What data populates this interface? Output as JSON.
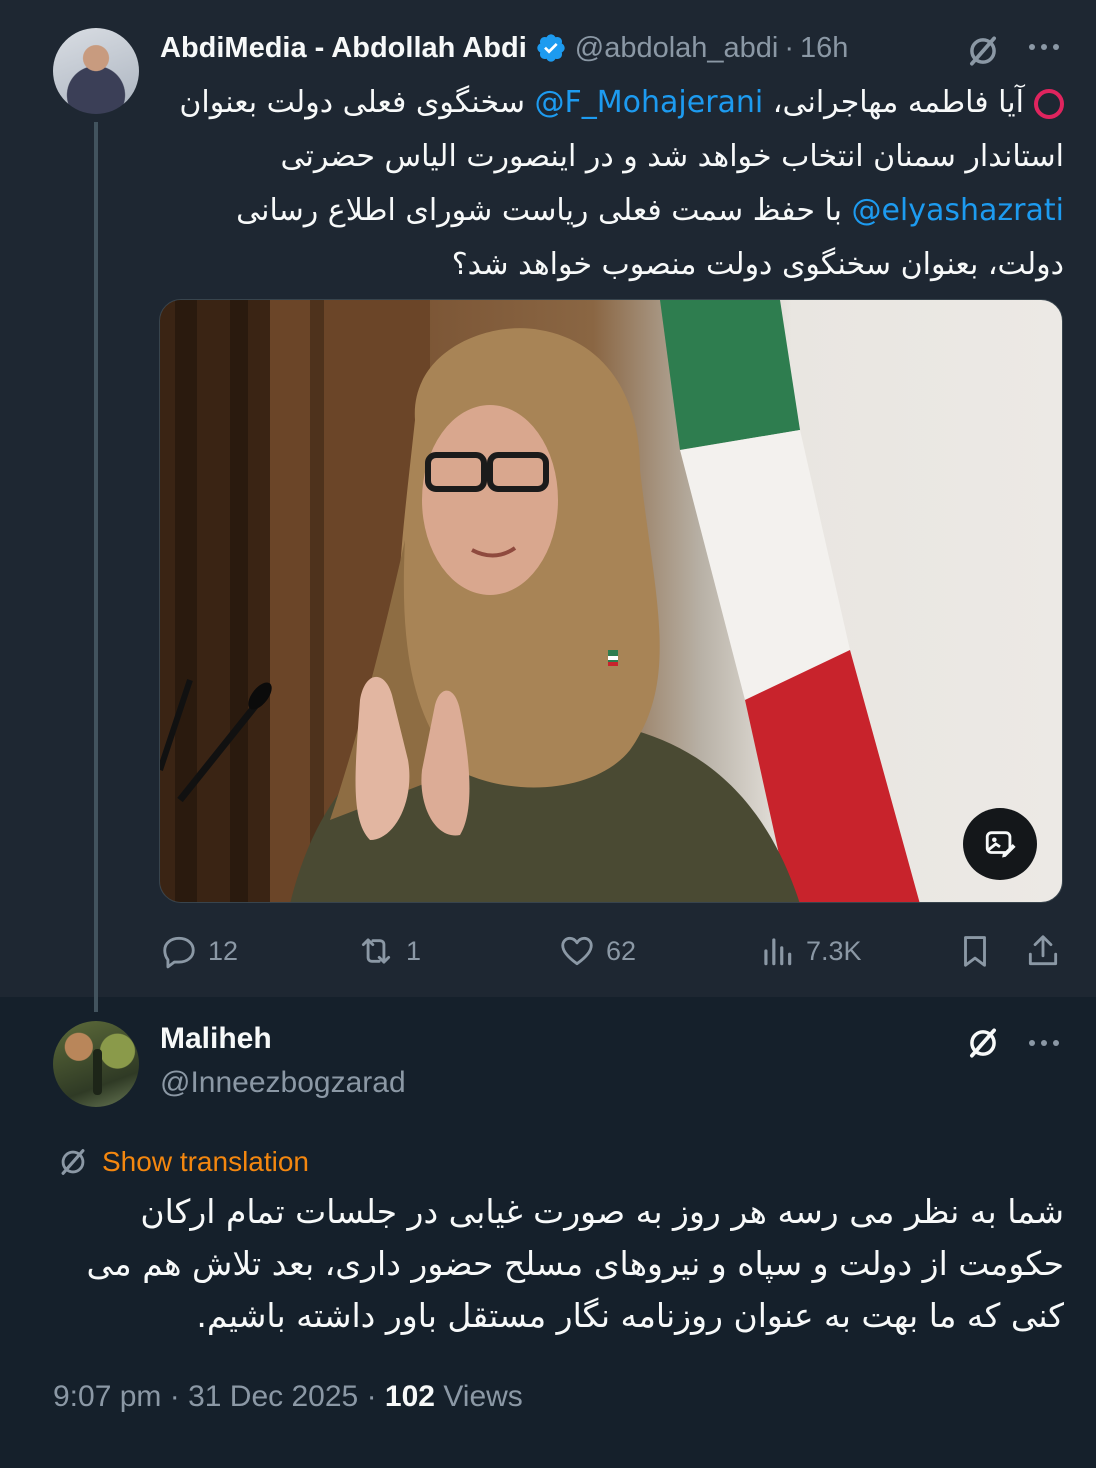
{
  "parent_tweet": {
    "author_name": "AbdiMedia - Abdollah Abdi",
    "handle": "@abdolah_abdi",
    "time": "16h",
    "separator": "·",
    "text_line1_pre": "آیا فاطمه مهاجرانی، ",
    "mention1": "@F_Mohajerani",
    "text_line1_post": " سخنگوی فعلی دولت بعنوان استاندار سمنان انتخاب خواهد شد و در اینصورت الیاس حضرتی ",
    "mention2": "@elyashazrati",
    "text_line2_post": " با حفظ سمت فعلی ریاست شورای اطلاع رسانی دولت، بعنوان سخنگوی دولت منصوب خواهد شد؟",
    "stats": {
      "replies": "12",
      "reposts": "1",
      "likes": "62",
      "views": "7.3K"
    }
  },
  "reply": {
    "author_name": "Maliheh",
    "handle": "@Inneezbogzarad",
    "show_translation": "Show translation",
    "text": "شما به نظر می رسه هر روز به صورت غیابی در جلسات تمام ارکان حکومت از دولت و سپاه و نیروهای مسلح حضور داری، بعد تلاش هم می کنی که ما بهت به عنوان روزنامه نگار مستقل باور داشته باشیم.",
    "time": "9:07 pm",
    "date": "31 Dec 2025",
    "separator": "·",
    "views_count": "102",
    "views_label": "Views"
  },
  "colors": {
    "background": "#15202b",
    "parent_background": "#1e2732",
    "accent_blue": "#1d9bf0",
    "muted": "#8b98a5",
    "translation_orange": "#f4870f",
    "alert_red": "#e0245e"
  },
  "icons": [
    "verified-badge-icon",
    "grok-icon",
    "more-icon",
    "reply-icon",
    "repost-icon",
    "like-icon",
    "views-icon",
    "bookmark-icon",
    "share-icon",
    "alt-text-icon",
    "translate-icon",
    "red-circle-icon"
  ]
}
